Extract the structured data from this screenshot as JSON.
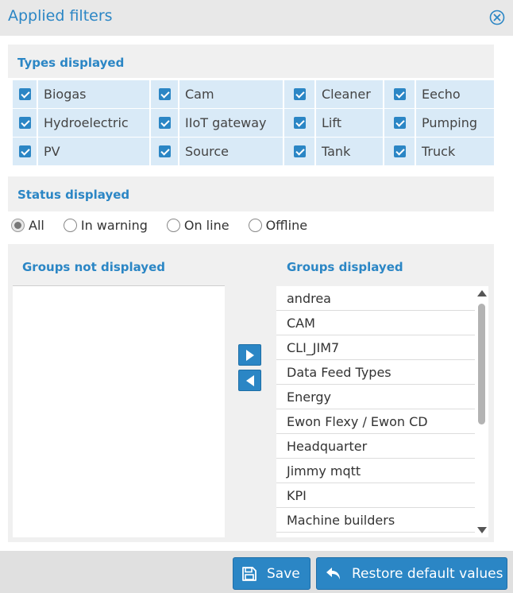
{
  "window": {
    "title": "Applied filters"
  },
  "types": {
    "title": "Types displayed",
    "items": [
      {
        "label": "Biogas",
        "checked": true
      },
      {
        "label": "Cam",
        "checked": true
      },
      {
        "label": "Cleaner",
        "checked": true
      },
      {
        "label": "Eecho",
        "checked": true
      },
      {
        "label": "Hydroelectric",
        "checked": true
      },
      {
        "label": "IIoT gateway",
        "checked": true
      },
      {
        "label": "Lift",
        "checked": true
      },
      {
        "label": "Pumping",
        "checked": true
      },
      {
        "label": "PV",
        "checked": true
      },
      {
        "label": "Source",
        "checked": true
      },
      {
        "label": "Tank",
        "checked": true
      },
      {
        "label": "Truck",
        "checked": true
      }
    ]
  },
  "status": {
    "title": "Status displayed",
    "options": [
      {
        "label": "All",
        "selected": true
      },
      {
        "label": "In warning",
        "selected": false
      },
      {
        "label": "On line",
        "selected": false
      },
      {
        "label": "Offline",
        "selected": false
      }
    ]
  },
  "groups": {
    "not_displayed_title": "Groups not displayed",
    "displayed_title": "Groups displayed",
    "not_displayed": [],
    "displayed": [
      "andrea",
      "CAM",
      "CLI_JIM7",
      "Data Feed Types",
      "Energy",
      "Ewon Flexy / Ewon CD",
      "Headquarter",
      "Jimmy mqtt",
      "KPI",
      "Machine builders"
    ]
  },
  "footer": {
    "save_label": "Save",
    "restore_label": "Restore default values"
  },
  "colors": {
    "accent": "#2b86c5",
    "cell_bg": "#d9eaf7",
    "panel_bg": "#f0f0f0"
  },
  "icons": {
    "close": "close-circle-icon",
    "save": "floppy-disk-icon",
    "restore": "undo-arrow-icon"
  }
}
